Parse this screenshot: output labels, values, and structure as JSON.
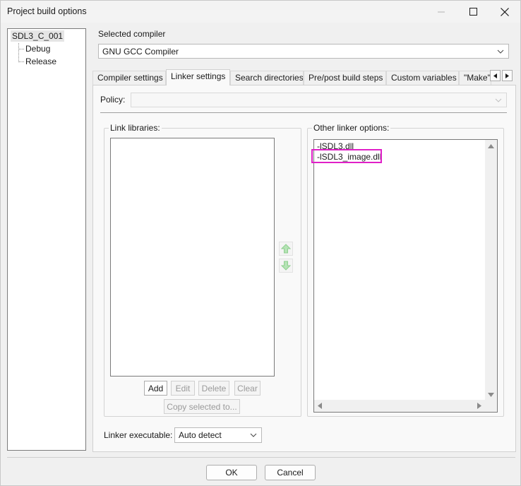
{
  "window": {
    "title": "Project build options"
  },
  "tree": {
    "root": "SDL3_C_001",
    "children": [
      "Debug",
      "Release"
    ]
  },
  "compiler": {
    "label": "Selected compiler",
    "value": "GNU GCC Compiler"
  },
  "tabs": [
    {
      "label": "Compiler settings",
      "active": false
    },
    {
      "label": "Linker settings",
      "active": true
    },
    {
      "label": "Search directories",
      "active": false
    },
    {
      "label": "Pre/post build steps",
      "active": false
    },
    {
      "label": "Custom variables",
      "active": false
    },
    {
      "label": "\"Make\"",
      "active": false
    }
  ],
  "policy": {
    "label": "Policy:",
    "value": ""
  },
  "link_libraries": {
    "title": "Link libraries:",
    "items": [],
    "buttons": {
      "add": "Add",
      "edit": "Edit",
      "delete": "Delete",
      "clear": "Clear",
      "copy": "Copy selected to..."
    }
  },
  "other_options": {
    "title": "Other linker options:",
    "lines": [
      "-lSDL3.dll",
      "-lSDL3_image.dll"
    ]
  },
  "linker_executable": {
    "label": "Linker executable:",
    "value": "Auto detect"
  },
  "footer": {
    "ok": "OK",
    "cancel": "Cancel"
  },
  "colors": {
    "highlight": "#e020c8",
    "move_arrows": "#8fcf8f"
  }
}
